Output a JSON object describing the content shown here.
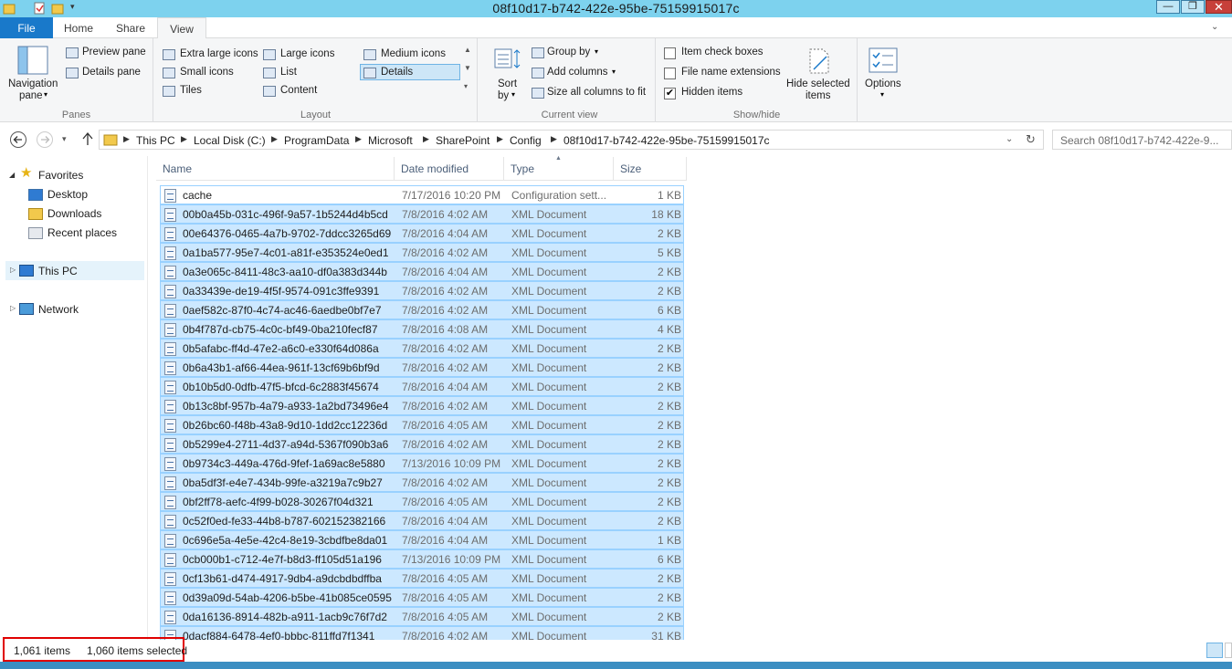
{
  "window": {
    "title": "08f10d17-b742-422e-95be-75159915017c"
  },
  "tabs": [
    {
      "label": "File"
    },
    {
      "label": "Home"
    },
    {
      "label": "Share"
    },
    {
      "label": "View"
    }
  ],
  "ribbon": {
    "panes": {
      "navigation_pane": "Navigation",
      "navigation_pane2": "pane",
      "preview_pane": "Preview pane",
      "details_pane": "Details pane",
      "label": "Panes"
    },
    "layout": {
      "items": [
        "Extra large icons",
        "Large icons",
        "Medium icons",
        "Small icons",
        "List",
        "Details",
        "Tiles",
        "Content"
      ],
      "selected": "Details",
      "label": "Layout"
    },
    "current_view": {
      "sort_by": "Sort",
      "sort_by2": "by",
      "group_by": "Group by",
      "add_columns": "Add columns",
      "size_all_columns": "Size all columns to fit",
      "label": "Current view"
    },
    "show_hide": {
      "item_check_boxes": "Item check boxes",
      "file_name_extensions": "File name extensions",
      "hidden_items": "Hidden items",
      "hide_selected": "Hide selected",
      "hide_selected2": "items",
      "label": "Show/hide"
    },
    "options": "Options"
  },
  "address": {
    "crumbs": [
      "This PC",
      "Local Disk (C:)",
      "ProgramData",
      "Microsoft",
      "SharePoint",
      "Config",
      "08f10d17-b742-422e-95be-75159915017c"
    ],
    "search_placeholder": "Search 08f10d17-b742-422e-9..."
  },
  "nav": {
    "favorites": "Favorites",
    "desktop": "Desktop",
    "downloads": "Downloads",
    "recent_places": "Recent places",
    "this_pc": "This PC",
    "network": "Network"
  },
  "columns": {
    "name": "Name",
    "date_modified": "Date modified",
    "type": "Type",
    "size": "Size"
  },
  "files": [
    {
      "name": "cache",
      "date": "7/17/2016 10:20 PM",
      "type": "Configuration sett...",
      "size": "1 KB"
    },
    {
      "name": "00b0a45b-031c-496f-9a57-1b5244d4b5cd",
      "date": "7/8/2016 4:02 AM",
      "type": "XML Document",
      "size": "18 KB"
    },
    {
      "name": "00e64376-0465-4a7b-9702-7ddcc3265d69",
      "date": "7/8/2016 4:04 AM",
      "type": "XML Document",
      "size": "2 KB"
    },
    {
      "name": "0a1ba577-95e7-4c01-a81f-e353524e0ed1",
      "date": "7/8/2016 4:02 AM",
      "type": "XML Document",
      "size": "5 KB"
    },
    {
      "name": "0a3e065c-8411-48c3-aa10-df0a383d344b",
      "date": "7/8/2016 4:04 AM",
      "type": "XML Document",
      "size": "2 KB"
    },
    {
      "name": "0a33439e-de19-4f5f-9574-091c3ffe9391",
      "date": "7/8/2016 4:02 AM",
      "type": "XML Document",
      "size": "2 KB"
    },
    {
      "name": "0aef582c-87f0-4c74-ac46-6aedbe0bf7e7",
      "date": "7/8/2016 4:02 AM",
      "type": "XML Document",
      "size": "6 KB"
    },
    {
      "name": "0b4f787d-cb75-4c0c-bf49-0ba210fecf87",
      "date": "7/8/2016 4:08 AM",
      "type": "XML Document",
      "size": "4 KB"
    },
    {
      "name": "0b5afabc-ff4d-47e2-a6c0-e330f64d086a",
      "date": "7/8/2016 4:02 AM",
      "type": "XML Document",
      "size": "2 KB"
    },
    {
      "name": "0b6a43b1-af66-44ea-961f-13cf69b6bf9d",
      "date": "7/8/2016 4:02 AM",
      "type": "XML Document",
      "size": "2 KB"
    },
    {
      "name": "0b10b5d0-0dfb-47f5-bfcd-6c2883f45674",
      "date": "7/8/2016 4:04 AM",
      "type": "XML Document",
      "size": "2 KB"
    },
    {
      "name": "0b13c8bf-957b-4a79-a933-1a2bd73496e4",
      "date": "7/8/2016 4:02 AM",
      "type": "XML Document",
      "size": "2 KB"
    },
    {
      "name": "0b26bc60-f48b-43a8-9d10-1dd2cc12236d",
      "date": "7/8/2016 4:05 AM",
      "type": "XML Document",
      "size": "2 KB"
    },
    {
      "name": "0b5299e4-2711-4d37-a94d-5367f090b3a6",
      "date": "7/8/2016 4:02 AM",
      "type": "XML Document",
      "size": "2 KB"
    },
    {
      "name": "0b9734c3-449a-476d-9fef-1a69ac8e5880",
      "date": "7/13/2016 10:09 PM",
      "type": "XML Document",
      "size": "2 KB"
    },
    {
      "name": "0ba5df3f-e4e7-434b-99fe-a3219a7c9b27",
      "date": "7/8/2016 4:02 AM",
      "type": "XML Document",
      "size": "2 KB"
    },
    {
      "name": "0bf2ff78-aefc-4f99-b028-30267f04d321",
      "date": "7/8/2016 4:05 AM",
      "type": "XML Document",
      "size": "2 KB"
    },
    {
      "name": "0c52f0ed-fe33-44b8-b787-602152382166",
      "date": "7/8/2016 4:04 AM",
      "type": "XML Document",
      "size": "2 KB"
    },
    {
      "name": "0c696e5a-4e5e-42c4-8e19-3cbdfbe8da01",
      "date": "7/8/2016 4:04 AM",
      "type": "XML Document",
      "size": "1 KB"
    },
    {
      "name": "0cb000b1-c712-4e7f-b8d3-ff105d51a196",
      "date": "7/13/2016 10:09 PM",
      "type": "XML Document",
      "size": "6 KB"
    },
    {
      "name": "0cf13b61-d474-4917-9db4-a9dcbdbdffba",
      "date": "7/8/2016 4:05 AM",
      "type": "XML Document",
      "size": "2 KB"
    },
    {
      "name": "0d39a09d-54ab-4206-b5be-41b085ce0595",
      "date": "7/8/2016 4:05 AM",
      "type": "XML Document",
      "size": "2 KB"
    },
    {
      "name": "0da16136-8914-482b-a911-1acb9c76f7d2",
      "date": "7/8/2016 4:05 AM",
      "type": "XML Document",
      "size": "2 KB"
    },
    {
      "name": "0dacf884-6478-4ef0-bbbc-811ffd7f1341",
      "date": "7/8/2016 4:02 AM",
      "type": "XML Document",
      "size": "31 KB"
    }
  ],
  "status": {
    "item_count": "1,061 items",
    "selected_count": "1,060 items selected"
  },
  "colors": {
    "titlebar": "#7dd2ee",
    "file_tab": "#1979ca",
    "selection": "#cce8ff",
    "highlight": "#e00000"
  }
}
